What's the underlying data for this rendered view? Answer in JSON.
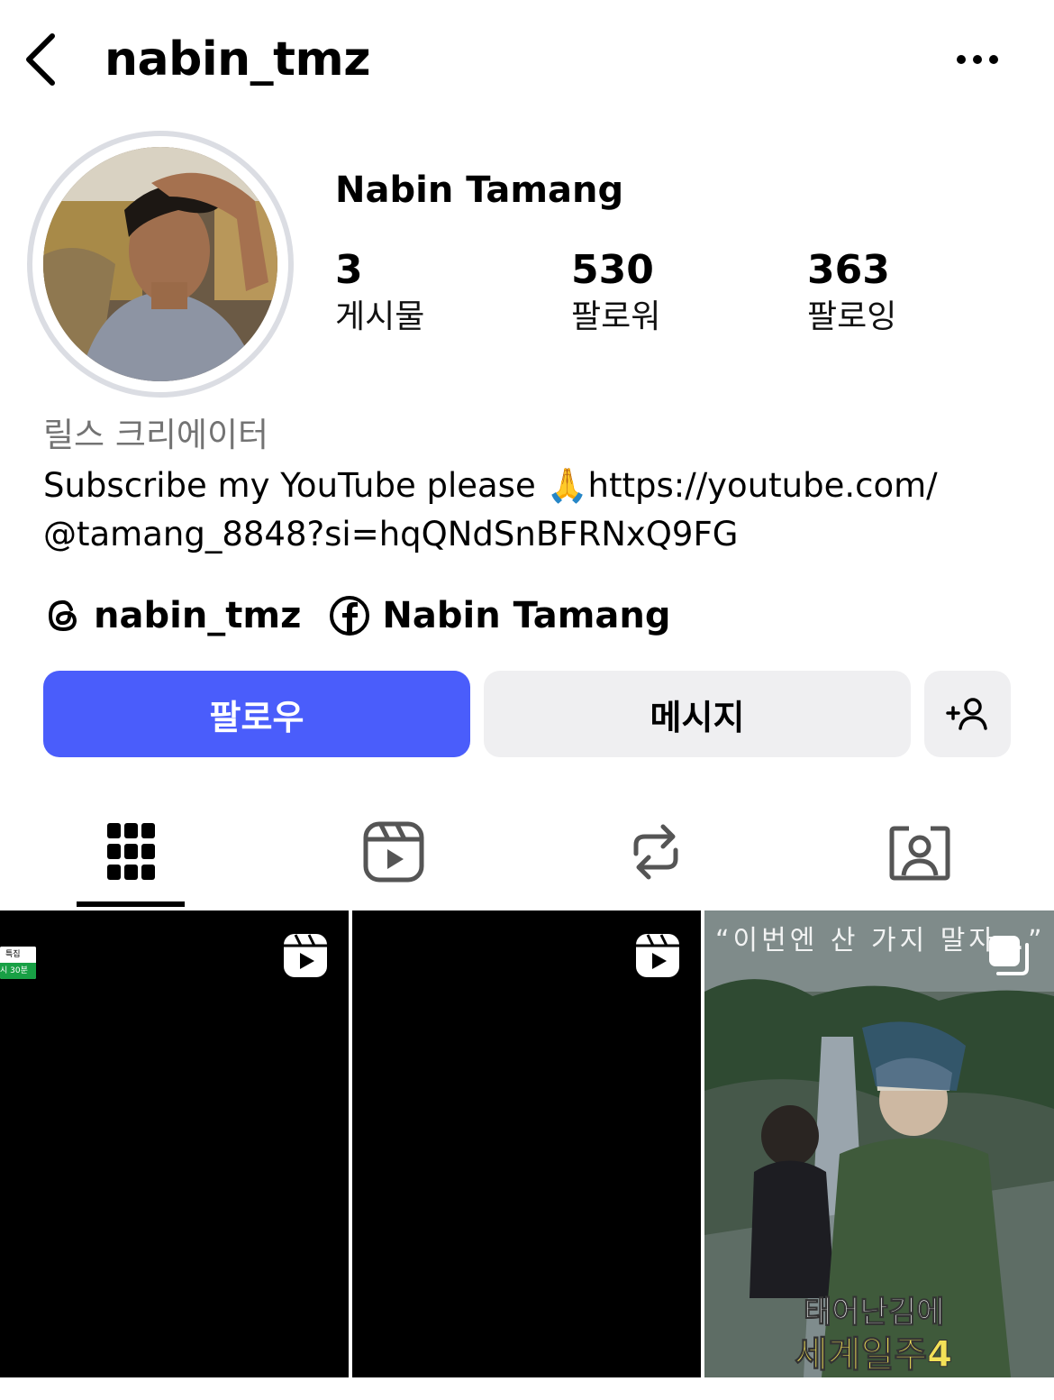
{
  "header": {
    "username": "nabin_tmz",
    "back_icon": "chevron-left-icon",
    "more_icon": "ellipsis-icon"
  },
  "profile": {
    "display_name": "Nabin Tamang",
    "stats": {
      "posts": {
        "value": "3",
        "label": "게시물"
      },
      "followers": {
        "value": "530",
        "label": "팔로워"
      },
      "following": {
        "value": "363",
        "label": "팔로잉"
      }
    },
    "category": "릴스 크리에이터",
    "bio_line1": "Subscribe my YouTube please 🙏https://youtube.com/",
    "bio_line2": "@tamang_8848?si=hqQNdSnBFRNxQ9FG",
    "links": {
      "threads": {
        "icon": "threads-icon",
        "label": "nabin_tmz"
      },
      "facebook": {
        "icon": "facebook-icon",
        "label": "Nabin Tamang"
      }
    }
  },
  "actions": {
    "follow_label": "팔로우",
    "message_label": "메시지",
    "suggest_icon": "add-person-icon"
  },
  "tabs": [
    {
      "name": "posts-grid",
      "icon": "grid-icon",
      "active": true
    },
    {
      "name": "reels",
      "icon": "reels-icon",
      "active": false
    },
    {
      "name": "reposts",
      "icon": "repost-icon",
      "active": false
    },
    {
      "name": "tagged",
      "icon": "tagged-person-icon",
      "active": false
    }
  ],
  "posts": [
    {
      "type": "reel",
      "badge_line1": "특집",
      "badge_line2": "시 30분"
    },
    {
      "type": "reel"
    },
    {
      "type": "carousel",
      "quote_text": "“이번엔 산 가지 말자…”",
      "title_line1": "태어난김에",
      "title_line2": "세계일주4"
    }
  ],
  "colors": {
    "follow_button": "#4a5dfb",
    "secondary_button": "#efeff1",
    "muted_text": "#737373"
  }
}
